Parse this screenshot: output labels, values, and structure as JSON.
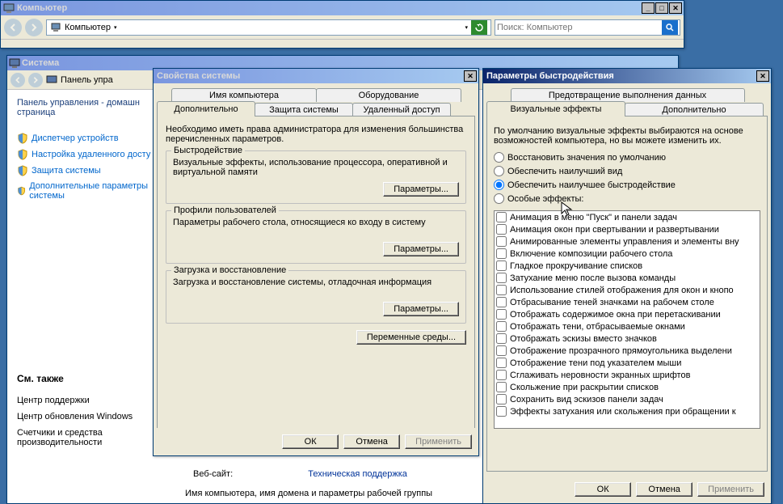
{
  "explorer": {
    "title": "Компьютер",
    "addr_prefix": "Компьютер",
    "search_placeholder": "Поиск: Компьютер"
  },
  "system": {
    "title": "Система",
    "breadcrumb": "Панель упра",
    "sidebar_heading": "Панель управления - домашн\nстраница",
    "sidebar_items": [
      "Диспетчер устройств",
      "Настройка удаленного досту",
      "Защита системы",
      "Дополнительные параметры системы"
    ],
    "see_also_title": "См. также",
    "see_also": [
      "Центр поддержки",
      "Центр обновления Windows",
      "Счетчики и средства производительности"
    ],
    "website_label": "Веб-сайт:",
    "techsupport_label": "Техническая поддержка",
    "domain_label": "Имя компьютера, имя домена и параметры рабочей группы"
  },
  "sysprops": {
    "title": "Свойства системы",
    "tabs_row1": [
      "Имя компьютера",
      "Оборудование"
    ],
    "tabs_row2": [
      "Дополнительно",
      "Защита системы",
      "Удаленный доступ"
    ],
    "admin_note": "Необходимо иметь права администратора для изменения большинства перечисленных параметров.",
    "perf_title": "Быстродействие",
    "perf_desc": "Визуальные эффекты, использование процессора, оперативной и виртуальной памяти",
    "params_btn": "Параметры...",
    "profiles_title": "Профили пользователей",
    "profiles_desc": "Параметры рабочего стола, относящиеся ко входу в систему",
    "startup_title": "Загрузка и восстановление",
    "startup_desc": "Загрузка и восстановление системы, отладочная информация",
    "env_btn": "Переменные среды...",
    "ok": "ОК",
    "cancel": "Отмена",
    "apply": "Применить"
  },
  "perfopts": {
    "title": "Параметры быстродействия",
    "tabs_row1": [
      "Предотвращение выполнения данных"
    ],
    "tabs_row2": [
      "Визуальные эффекты",
      "Дополнительно"
    ],
    "intro": "По умолчанию визуальные эффекты выбираются на основе возможностей компьютера, но вы можете изменить их.",
    "radios": [
      "Восстановить значения по умолчанию",
      "Обеспечить наилучший вид",
      "Обеспечить наилучшее быстродействие",
      "Особые эффекты:"
    ],
    "radio_selected": 2,
    "effects": [
      "Анимация в меню \"Пуск\" и панели задач",
      "Анимация окон при свертывании и развертывании",
      "Анимированные элементы управления и элементы вну",
      "Включение композиции рабочего стола",
      "Гладкое прокручивание списков",
      "Затухание меню после вызова команды",
      "Использование стилей отображения для окон и кнопо",
      "Отбрасывание теней значками на рабочем столе",
      "Отображать содержимое окна при перетаскивании",
      "Отображать тени, отбрасываемые окнами",
      "Отображать эскизы вместо значков",
      "Отображение прозрачного прямоугольника выделени",
      "Отображение тени под указателем мыши",
      "Сглаживать неровности экранных шрифтов",
      "Скольжение при раскрытии списков",
      "Сохранить вид эскизов панели задач",
      "Эффекты затухания или скольжения при обращении к"
    ],
    "ok": "ОК",
    "cancel": "Отмена",
    "apply": "Применить"
  }
}
